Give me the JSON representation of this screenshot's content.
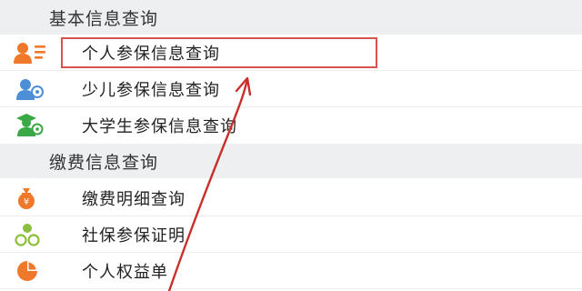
{
  "sections": [
    {
      "title": "基本信息查询",
      "items": [
        {
          "label": "个人参保信息查询",
          "icon": "person-card-icon"
        },
        {
          "label": "少儿参保信息查询",
          "icon": "child-icon"
        },
        {
          "label": "大学生参保信息查询",
          "icon": "student-icon"
        }
      ]
    },
    {
      "title": "缴费信息查询",
      "items": [
        {
          "label": "缴费明细查询",
          "icon": "money-bag-icon"
        },
        {
          "label": "社保参保证明",
          "icon": "certificate-icon"
        },
        {
          "label": "个人权益单",
          "icon": "pie-chart-icon"
        }
      ]
    }
  ],
  "colors": {
    "icon_orange": "#f0782a",
    "icon_blue": "#4d8fd6",
    "icon_green": "#3aa845",
    "icon_lime": "#8bbf3c",
    "highlight_red": "#d9534f",
    "arrow_red": "#c9302c",
    "section_bg": "#eeeff1"
  }
}
